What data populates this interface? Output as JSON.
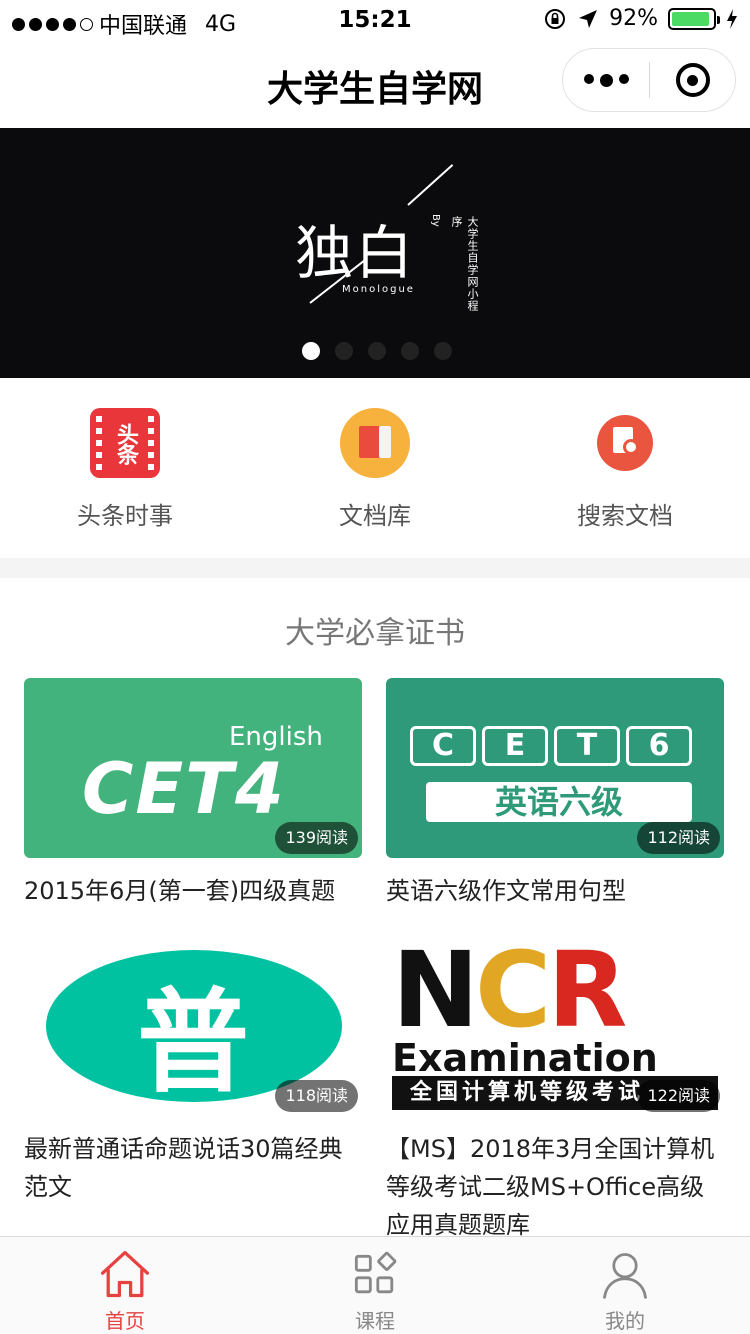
{
  "status_bar": {
    "carrier": "中国联通",
    "network": "4G",
    "time": "15:21",
    "battery": "92%",
    "battery_level": 0.92,
    "signal_bars": 4
  },
  "nav": {
    "title": "大学生自学网"
  },
  "banner": {
    "main_text": "独白",
    "sub_text": "Monologue",
    "by_text": "By",
    "side_text": "大学生自学网小程序",
    "slide_count": 5,
    "active_slide": 1
  },
  "quick_menu": [
    {
      "label": "头条时事",
      "icon": "news-icon",
      "icon_text": "头条"
    },
    {
      "label": "文档库",
      "icon": "document-library-icon"
    },
    {
      "label": "搜索文档",
      "icon": "search-document-icon"
    }
  ],
  "section": {
    "title": "大学必拿证书"
  },
  "cards": [
    {
      "title": "2015年6月(第一套)四级真题",
      "reads": "139阅读",
      "thumb_top": "English",
      "thumb_main": "CET4"
    },
    {
      "title": "英语六级作文常用句型",
      "reads": "112阅读",
      "thumb_boxes": [
        "C",
        "E",
        "T",
        "6"
      ],
      "thumb_cn": "英语六级"
    },
    {
      "title": "最新普通话命题说话30篇经典范文",
      "reads": "118阅读",
      "thumb_char": "普"
    },
    {
      "title": "【MS】2018年3月全国计算机等级考试二级MS+Office高级应用真题题库",
      "reads": "122阅读",
      "thumb_letters": "NCR",
      "thumb_exam": "Examination",
      "thumb_bar": "全国计算机等级考试"
    }
  ],
  "tab_bar": [
    {
      "label": "首页",
      "icon": "home-icon",
      "active": true
    },
    {
      "label": "课程",
      "icon": "course-grid-icon",
      "active": false
    },
    {
      "label": "我的",
      "icon": "user-icon",
      "active": false
    }
  ],
  "colors": {
    "accent": "#e64340",
    "banner_bg": "#0b0b0d",
    "cet4_green": "#43b37d",
    "cet6_green": "#2f9a7a",
    "pth_teal": "#00c1a0",
    "battery_green": "#4cd964"
  }
}
